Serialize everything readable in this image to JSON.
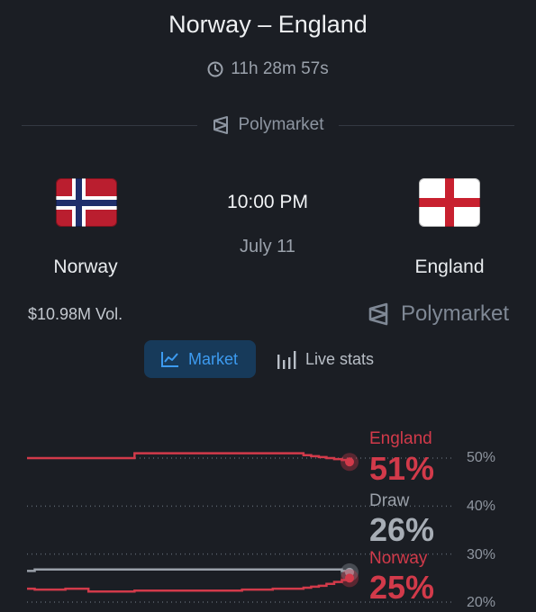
{
  "header": {
    "title": "Norway – England",
    "countdown": "11h 28m 57s",
    "provider": "Polymarket"
  },
  "match": {
    "home": {
      "name": "Norway",
      "flag": "flag-norway"
    },
    "away": {
      "name": "England",
      "flag": "flag-england"
    },
    "time": "10:00 PM",
    "date": "July 11",
    "volume": "$10.98M Vol.",
    "brand": "Polymarket"
  },
  "tabs": [
    {
      "label": "Market",
      "icon": "line-chart-icon",
      "active": true
    },
    {
      "label": "Live stats",
      "icon": "bar-stats-icon",
      "active": false
    }
  ],
  "colors": {
    "england": "#d23a4a",
    "draw": "#9aa0a9",
    "norway": "#d23a4a",
    "accent": "#3d9bf0"
  },
  "chart_data": {
    "type": "line",
    "ylim": [
      20,
      50
    ],
    "yticks": [
      "50%",
      "40%",
      "30%",
      "20%"
    ],
    "series": [
      {
        "name": "England",
        "label": "51%",
        "values": [
          50,
          50,
          50,
          50,
          50,
          50,
          50,
          50,
          50,
          50,
          50,
          50,
          50,
          50,
          51,
          51,
          51,
          51,
          51,
          51,
          51,
          51,
          51,
          51,
          51,
          51,
          51,
          51,
          51,
          51,
          51,
          51,
          51,
          51,
          51,
          51,
          50.6,
          50.4,
          50.2,
          50,
          49.8,
          49.6,
          49.2
        ]
      },
      {
        "name": "Draw",
        "label": "26%",
        "values": [
          26.5,
          26.8,
          26.8,
          26.8,
          26.8,
          26.8,
          26.8,
          26.8,
          26.8,
          26.8,
          26.8,
          26.8,
          26.8,
          26.8,
          26.8,
          26.8,
          26.8,
          26.8,
          26.8,
          26.8,
          26.8,
          26.8,
          26.8,
          26.8,
          26.8,
          26.8,
          26.8,
          26.8,
          26.8,
          26.8,
          26.8,
          26.8,
          26.8,
          26.8,
          26.8,
          26.8,
          26.8,
          26.8,
          26.8,
          26.8,
          26.8,
          26.5,
          26.2
        ]
      },
      {
        "name": "Norway",
        "label": "25%",
        "values": [
          22.8,
          22.6,
          22.6,
          22.6,
          22.6,
          22.8,
          22.8,
          22.8,
          22.2,
          22.2,
          22.2,
          22.2,
          22.2,
          22.2,
          22.4,
          22.4,
          22.4,
          22.4,
          22.4,
          22.4,
          22.4,
          22.4,
          22.4,
          22.4,
          22.4,
          22.4,
          22.4,
          22.4,
          22.6,
          22.6,
          22.6,
          22.6,
          22.8,
          22.8,
          22.8,
          22.8,
          23,
          23.2,
          23.4,
          23.8,
          24.2,
          24.6,
          25
        ]
      }
    ]
  }
}
